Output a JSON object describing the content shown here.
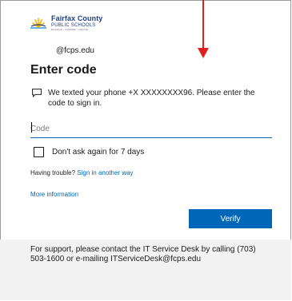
{
  "logo": {
    "name_line1": "Fairfax County",
    "name_line2": "PUBLIC SCHOOLS",
    "tagline": "ENGAGE • INSPIRE • THRIVE",
    "icon": "fcps-sun-logo-icon"
  },
  "account": {
    "email_suffix": "@fcps.edu"
  },
  "page": {
    "title": "Enter code"
  },
  "message": {
    "icon": "chat-message-icon",
    "text": "We texted your phone +X XXXXXXXX96. Please enter the code to sign in."
  },
  "code_field": {
    "placeholder": "Code",
    "value": ""
  },
  "remember": {
    "label": "Don't ask again for 7 days",
    "checked": false
  },
  "trouble": {
    "prefix": "Having trouble?",
    "link": "Sign in another way"
  },
  "more_info": {
    "label": "More information"
  },
  "verify_button": {
    "label": "Verify"
  },
  "support": {
    "text": "For support, please contact the IT Service Desk by calling (703) 503-1600 or e-mailing ITServiceDesk@fcps.edu"
  },
  "colors": {
    "accent": "#0067b8",
    "annotation_arrow": "#e0201c",
    "support_background": "#f2f2f2"
  }
}
